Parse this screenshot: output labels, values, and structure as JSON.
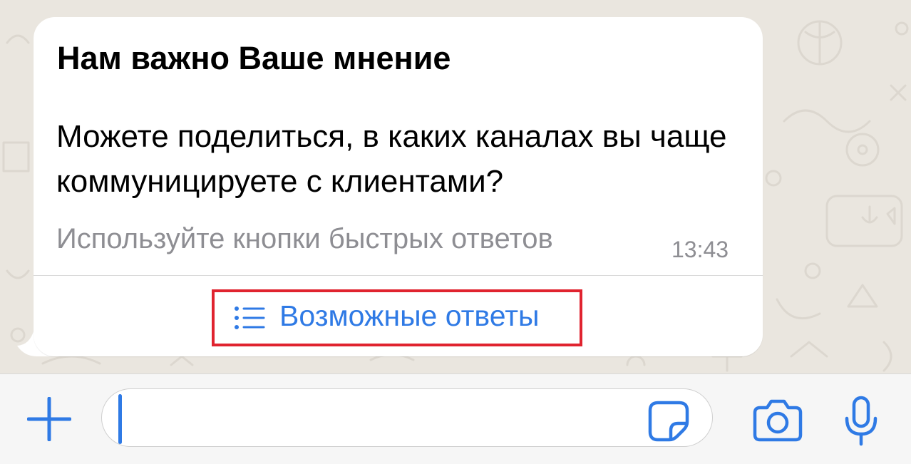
{
  "message": {
    "title": "Нам важно Ваше мнение",
    "body": "Можете поделиться, в каких каналах вы чаще коммуницируете с клиентами?",
    "footer": "Используйте кнопки быстрых ответов",
    "time": "13:43",
    "quick_replies_label": "Возможные ответы",
    "quick_replies_icon": "list-icon"
  },
  "input_bar": {
    "text_value": "",
    "attach_icon": "plus-icon",
    "sticker_icon": "sticker-icon",
    "camera_icon": "camera-icon",
    "mic_icon": "microphone-icon"
  },
  "colors": {
    "accent": "#2f7ae5",
    "highlight_border": "#e0232f",
    "chat_background": "#eae6df",
    "bubble": "#ffffff",
    "secondary_text": "#8e8e93"
  }
}
